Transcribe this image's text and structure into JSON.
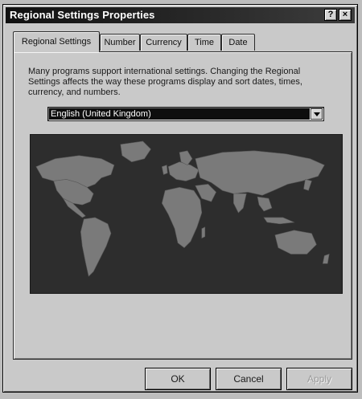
{
  "window": {
    "title": "Regional Settings Properties",
    "help_label": "?",
    "close_label": "×"
  },
  "tabs": [
    {
      "label": "Regional Settings",
      "active": true
    },
    {
      "label": "Number",
      "active": false
    },
    {
      "label": "Currency",
      "active": false
    },
    {
      "label": "Time",
      "active": false
    },
    {
      "label": "Date",
      "active": false
    }
  ],
  "panel": {
    "description": "Many programs support international settings. Changing the Regional Settings affects the way these programs display and sort dates, times, currency, and numbers.",
    "locale_select": {
      "value": "English (United Kingdom)",
      "icon": "chevron-down-icon"
    },
    "map": {
      "icon": "world-map",
      "colors": {
        "ocean": "#2d2d2d",
        "land": "#7a7a7a"
      }
    }
  },
  "buttons": {
    "ok": "OK",
    "cancel": "Cancel",
    "apply": "Apply"
  },
  "colors": {
    "titlebar": "#1e1e1e",
    "face": "#c9c9c9",
    "selection": "#0e0e0e"
  }
}
